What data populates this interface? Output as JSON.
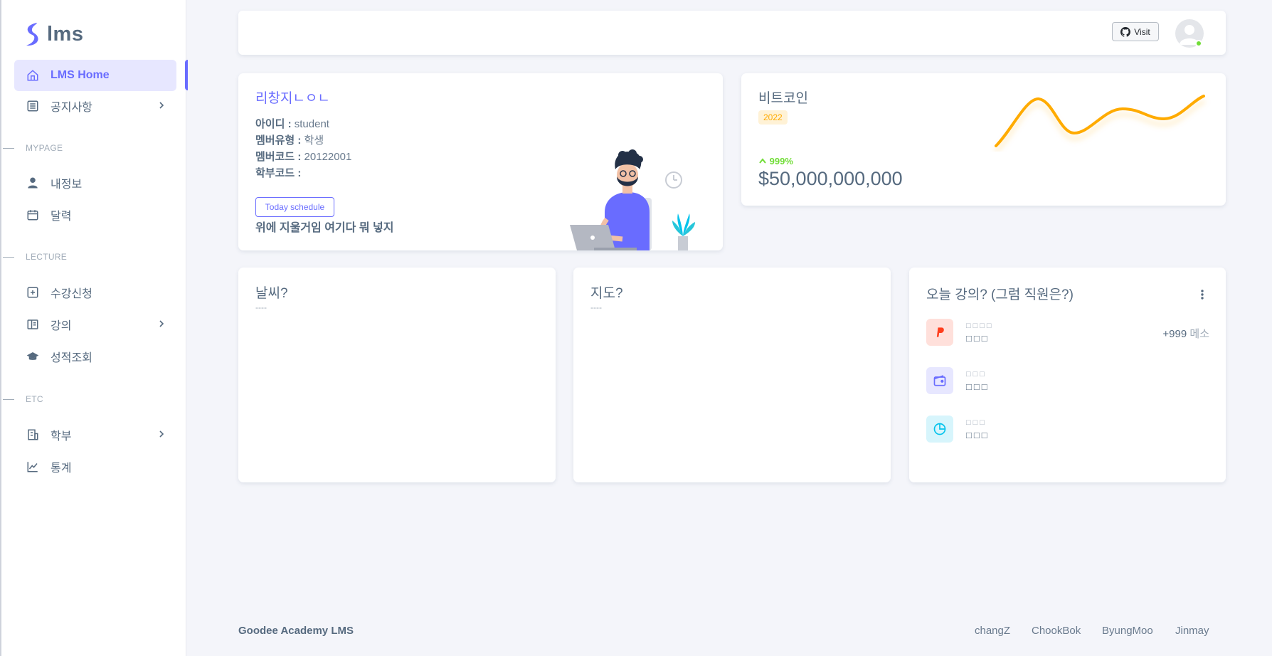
{
  "brand": {
    "name": "lms"
  },
  "sidebar": {
    "items": [
      {
        "label": "LMS Home"
      },
      {
        "label": "공지사항"
      },
      {
        "label": "내정보"
      },
      {
        "label": "달력"
      },
      {
        "label": "수강신청"
      },
      {
        "label": "강의"
      },
      {
        "label": "성적조회"
      },
      {
        "label": "학부"
      },
      {
        "label": "통계"
      }
    ],
    "headers": [
      "MYPAGE",
      "LECTURE",
      "ETC"
    ]
  },
  "navbar": {
    "visit_label": "Visit"
  },
  "profile": {
    "name": "리창지ㄴㅇㄴ",
    "id_label": "아이디 :",
    "id_value": "student",
    "type_label": "멤버유형 :",
    "type_value": "학생",
    "code_label": "멤버코드 :",
    "code_value": "20122001",
    "dept_label": "학부코드 :",
    "dept_value": "",
    "button_label": "Today schedule",
    "note": "위에 지울거임 여기다 뭐 넣지"
  },
  "bitcoin": {
    "title": "비트코인",
    "badge": "2022",
    "growth": "999%",
    "amount": "$50,000,000,000"
  },
  "weather": {
    "title": "날씨?",
    "placeholder": "----"
  },
  "map": {
    "title": "지도?",
    "placeholder": "----"
  },
  "lectures": {
    "title": "오늘 강의? (그럼 직원은?)",
    "rows": [
      {
        "line1": "□□□□",
        "line2": "□□□",
        "value": "+999",
        "unit": "메소",
        "icon": "paypal-icon",
        "color": "#ff3e1d"
      },
      {
        "line1": "□□□",
        "line2": "□□□",
        "icon": "wallet-icon",
        "color": "#696cff"
      },
      {
        "line1": "□□□",
        "line2": "□□□",
        "icon": "pie-chart-icon",
        "color": "#03c3ec"
      }
    ]
  },
  "footer": {
    "left": "Goodee Academy LMS",
    "links": [
      "changZ",
      "ChookBok",
      "ByungMoo",
      "Jinmay"
    ]
  },
  "colors": {
    "primary": "#696cff",
    "success": "#71dd37",
    "warning": "#ffab00",
    "danger": "#ff3e1d",
    "info": "#03c3ec"
  }
}
